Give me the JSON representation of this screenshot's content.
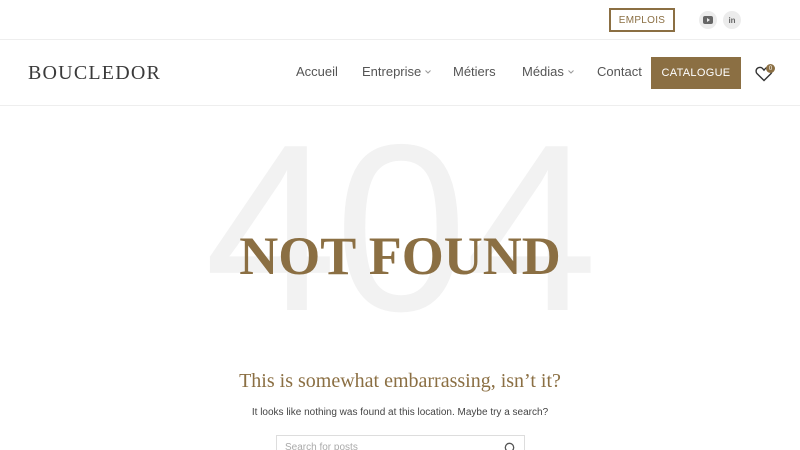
{
  "topbar": {
    "emplois_label": "EMPLOIS",
    "social": [
      {
        "icon": "youtube-icon"
      },
      {
        "icon": "linkedin-icon",
        "glyph": "in"
      }
    ]
  },
  "header": {
    "logo": "BOUCLEDOR",
    "nav": [
      {
        "label": "Accueil",
        "has_dropdown": false
      },
      {
        "label": "Entreprise",
        "has_dropdown": true
      },
      {
        "label": "Métiers",
        "has_dropdown": false
      },
      {
        "label": "Médias",
        "has_dropdown": true
      },
      {
        "label": "Contact",
        "has_dropdown": false
      }
    ],
    "catalogue_label": "CATALOGUE",
    "wishlist_count": "0"
  },
  "main": {
    "background_code": "404",
    "title": "NOT FOUND",
    "subtitle": "This is somewhat embarrassing, isn’t it?",
    "message": "It looks like nothing was found at this location. Maybe try a search?",
    "search": {
      "placeholder": "Search for posts"
    }
  },
  "colors": {
    "brand": "#8b6f43",
    "text": "#444444",
    "watermark": "#f2f2f2"
  }
}
